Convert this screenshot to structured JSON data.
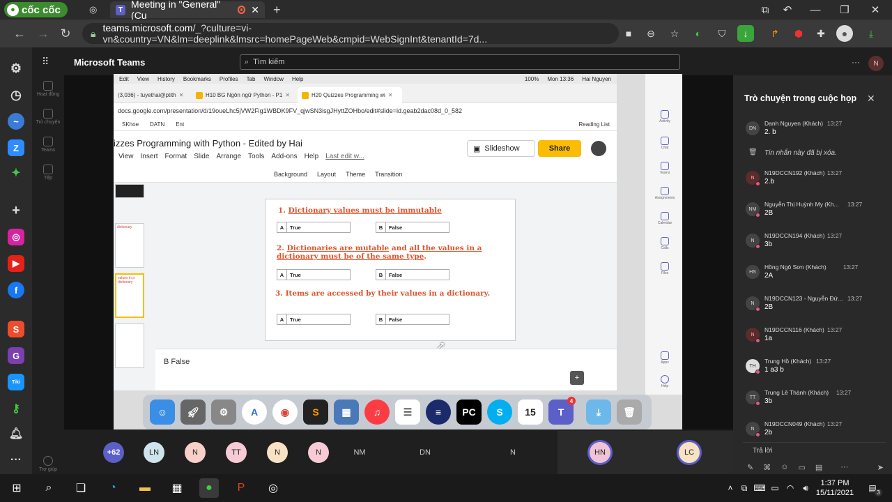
{
  "browser": {
    "brand": "cốc cốc",
    "tab_title": "Meeting in \"General\" (Cu",
    "new_tab": "+",
    "url_host": "teams.microsoft.com",
    "url_rest": "/_?culture=vi-vn&country=VN&lm=deeplink&lmsrc=homePageWeb&cmpid=WebSignInt&tenantId=7d..."
  },
  "teams": {
    "app_title": "Microsoft Teams",
    "search_placeholder": "Tìm kiếm",
    "user_initial": "N",
    "rail": [
      "Hoạt động",
      "Trò chuyện",
      "Teams",
      "Tệp"
    ],
    "rail_help": "Trợ giúp"
  },
  "shared": {
    "mac_menu": [
      "Edit",
      "View",
      "History",
      "Bookmarks",
      "Profiles",
      "Tab",
      "Window",
      "Help"
    ],
    "mac_status": "100%",
    "mac_clock": "Mon 13:36",
    "mac_user": "Hai Nguyen",
    "gtabs": [
      "(3,036) - tuyethai@ptith",
      "H10 BG Ngôn ngữ Python - P1",
      "H20 Quizzes Programming wi"
    ],
    "gaddr": "docs.google.com/presentation/d/19oueLhc5jVW2Fig1WBDK9FV_qjwSN3isgJHyttZOHbo/edit#slide=id.geab2dac08d_0_582",
    "bookmarks": [
      "SKhoe",
      "DATN",
      "Ent"
    ],
    "reading_list": "Reading List",
    "doc_title": "izzes Programming with Python - Edited by Hai",
    "doc_menu": [
      "View",
      "Insert",
      "Format",
      "Slide",
      "Arrange",
      "Tools",
      "Add-ons",
      "Help"
    ],
    "last_edit": "Last edit w...",
    "slideshow": "Slideshow",
    "share": "Share",
    "toolbar": [
      "Background",
      "Layout",
      "Theme",
      "Transition"
    ],
    "thumb_label_1": "dictionary",
    "thumb_label_2": "values in a dictionary",
    "q1_num": "1.",
    "q1": "Dictionary values must be immutable",
    "q2_num": "2.",
    "q2_a": "Dictionaries are mutable",
    "q2_b": "and",
    "q2_c": "all the values in a dictionary must be of the same type",
    "q2_d": ".",
    "q3": "3. Items are accessed by their values in a dictionary.",
    "opt_a_key": "A",
    "opt_a_val": "True",
    "opt_b_key": "B",
    "opt_b_val": "False",
    "notes": "B False",
    "calendar_day": "15",
    "teams_badge": "4",
    "rt_labels": [
      "Activity",
      "Chat",
      "Teams",
      "Assignments",
      "Calendar",
      "Calls",
      "Files",
      "Apps",
      "Help"
    ]
  },
  "participants": {
    "more": "+62",
    "list": [
      "LN",
      "N",
      "TT",
      "N",
      "N",
      "NM",
      "DN",
      "N",
      "HN",
      "LC"
    ]
  },
  "chat": {
    "title": "Trò chuyện trong cuộc họp",
    "deleted": "Tin nhắn này đã bị xóa.",
    "reply": "Trả lời",
    "messages": [
      {
        "init": "DN",
        "name": "Danh Nguyen (Khách)",
        "time": "13:27",
        "text": "2. b"
      },
      {
        "init": "N",
        "name": "N19DCCN192 (Khách)",
        "time": "13:27",
        "text": "2.b"
      },
      {
        "init": "NM",
        "name": "Nguyễn Thị Huỳnh My (Kh...",
        "time": "13:27",
        "text": "2B"
      },
      {
        "init": "N",
        "name": "N19DCCN194 (Khách)",
        "time": "13:27",
        "text": "3b"
      },
      {
        "init": "HS",
        "name": "Hồng Ngô Sơn (Khách)",
        "time": "13:27",
        "text": "2A"
      },
      {
        "init": "N",
        "name": "N19DCCN123 - Nguyễn Đứ...",
        "time": "13:27",
        "text": "2B"
      },
      {
        "init": "N",
        "name": "N19DCCN116 (Khách)",
        "time": "13:27",
        "text": "1a"
      },
      {
        "init": "TH",
        "name": "Trung Hồ (Khách)",
        "time": "13:27",
        "text": "1 a3 b"
      },
      {
        "init": "TT",
        "name": "Trung Lê Thành (Khách)",
        "time": "13:27",
        "text": "3b"
      },
      {
        "init": "N",
        "name": "N19DCCN049 (Khách)",
        "time": "13:27",
        "text": "2b"
      }
    ]
  },
  "taskbar": {
    "time": "1:37 PM",
    "date": "15/11/2021",
    "notif": "3"
  },
  "colors": {
    "accent": "#5b5fc7",
    "share_yellow": "#fbbc04",
    "quiz_orange": "#e0542d"
  }
}
